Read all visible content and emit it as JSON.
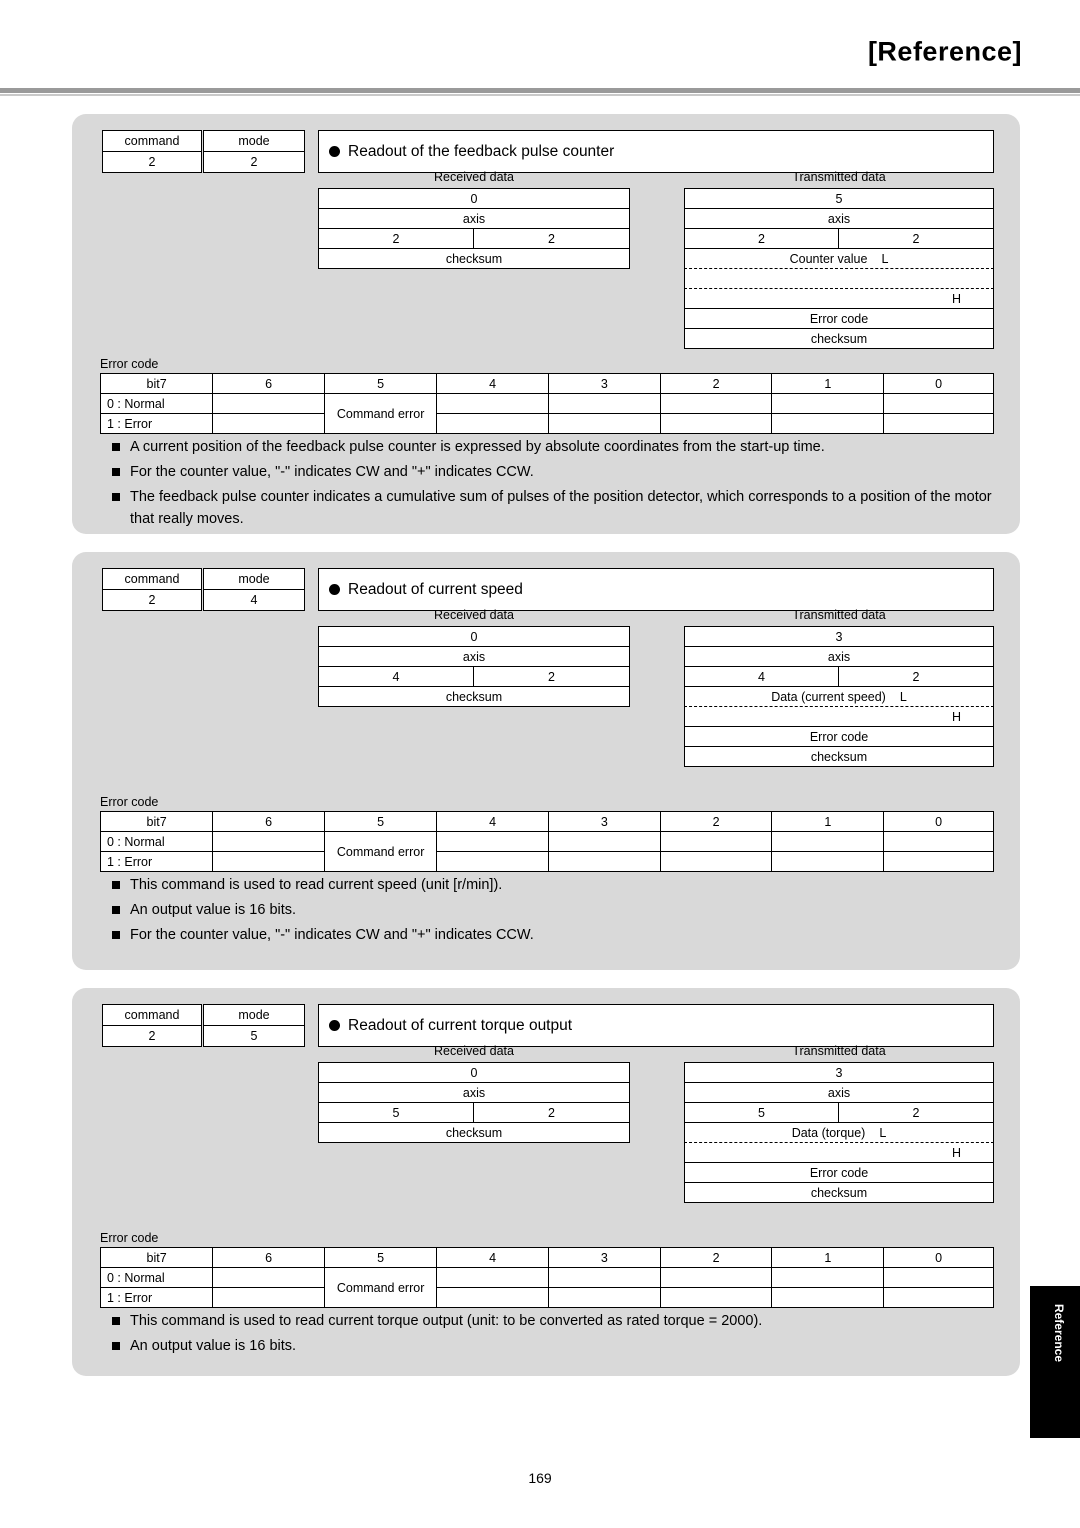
{
  "header": {
    "title": "[Reference]"
  },
  "page_number": "169",
  "side_tab": "Reference",
  "labels": {
    "command": "command",
    "mode": "mode",
    "received_data": "Received data",
    "transmitted_data": "Transmitted data",
    "axis": "axis",
    "checksum": "checksum",
    "error_code": "Error code"
  },
  "error_table": {
    "headers": [
      "bit7",
      "6",
      "5",
      "4",
      "3",
      "2",
      "1",
      "0"
    ],
    "row_label_1": "0 : Normal",
    "row_label_2": "1 : Error",
    "cell_command_error": "Command error"
  },
  "sections": [
    {
      "command": "2",
      "mode": "2",
      "title": "Readout of the feedback pulse counter",
      "received": {
        "row1": "0",
        "row2": "axis",
        "row3_left": "2",
        "row3_right": "2",
        "row4": "checksum"
      },
      "transmitted": {
        "row1": "5",
        "row2": "axis",
        "row3_left": "2",
        "row3_right": "2",
        "data_label": "Counter value",
        "data_low": "L",
        "data_high": "H",
        "error_code": "Error code",
        "checksum": "checksum"
      },
      "notes": [
        "A current position of the feedback pulse counter is expressed by absolute coordinates from the start-up time.",
        "For the counter value, \"-\" indicates CW and \"+\" indicates CCW.",
        "The feedback pulse counter indicates a cumulative sum of pulses of the position detector, which corresponds to a position of the motor that really moves."
      ]
    },
    {
      "command": "2",
      "mode": "4",
      "title": "Readout of current speed",
      "received": {
        "row1": "0",
        "row2": "axis",
        "row3_left": "4",
        "row3_right": "2",
        "row4": "checksum"
      },
      "transmitted": {
        "row1": "3",
        "row2": "axis",
        "row3_left": "4",
        "row3_right": "2",
        "data_label": "Data (current speed)",
        "data_low": "L",
        "data_high": "H",
        "error_code": "Error code",
        "checksum": "checksum"
      },
      "notes": [
        "This command is used to read current speed (unit [r/min]).",
        "An output value is 16 bits.",
        "For the counter value, \"-\" indicates CW and \"+\" indicates CCW."
      ]
    },
    {
      "command": "2",
      "mode": "5",
      "title": "Readout of current torque output",
      "received": {
        "row1": "0",
        "row2": "axis",
        "row3_left": "5",
        "row3_right": "2",
        "row4": "checksum"
      },
      "transmitted": {
        "row1": "3",
        "row2": "axis",
        "row3_left": "5",
        "row3_right": "2",
        "data_label": "Data (torque)",
        "data_low": "L",
        "data_high": "H",
        "error_code": "Error code",
        "checksum": "checksum"
      },
      "notes": [
        "This command is used to read current torque output (unit: to be converted as rated torque = 2000).",
        "An output value is 16 bits."
      ]
    }
  ]
}
